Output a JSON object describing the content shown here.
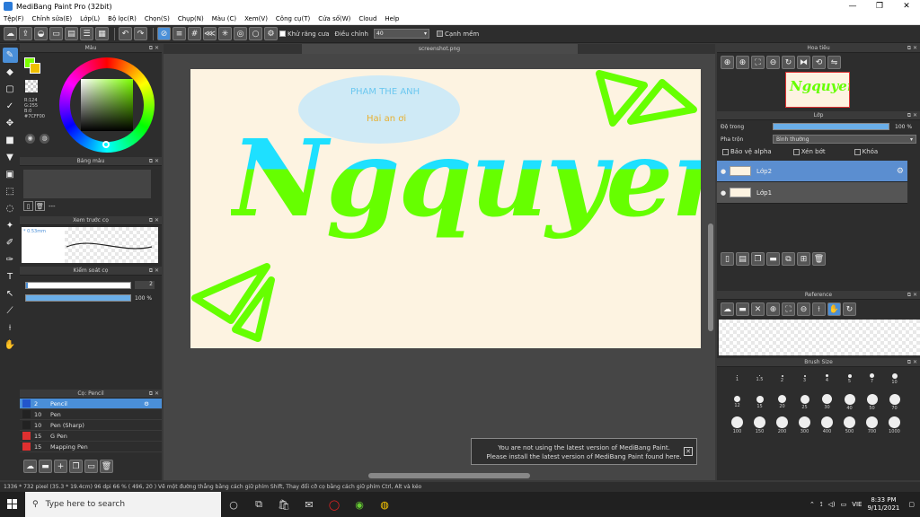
{
  "app": {
    "title": "MediBang Paint Pro (32bit)"
  },
  "window_controls": {
    "minimize": "—",
    "maximize": "❐",
    "close": "✕"
  },
  "menu": [
    "Tệp(F)",
    "Chỉnh sửa(E)",
    "Lớp(L)",
    "Bộ lọc(R)",
    "Chọn(S)",
    "Chụp(N)",
    "Màu (C)",
    "Xem(V)",
    "Công cụ(T)",
    "Cửa số(W)",
    "Cloud",
    "Help"
  ],
  "toolbar": {
    "antialias_label": "Khử răng cưa",
    "adjust_label": "Điều chỉnh",
    "adjust_value": "40",
    "snap_label": "Cạnh mềm"
  },
  "panels": {
    "color": {
      "title": "Màu",
      "r": "R:124",
      "g": "G:255",
      "b": "B:0",
      "hex": "#7CFF00",
      "accent": "#7cff00"
    },
    "palette": {
      "title": "Bảng màu",
      "extra": "---"
    },
    "preview": {
      "title": "Xem trước cọ",
      "size": "* 0.53mm"
    },
    "control": {
      "title": "Kiểm soát cọ",
      "size_value": "2",
      "opacity_value": "100 %"
    },
    "brush": {
      "title": "Cọ: Pencil",
      "items": [
        {
          "size": "2",
          "name": "Pencil",
          "color": "#2255cc",
          "selected": true
        },
        {
          "size": "10",
          "name": "Pen",
          "color": "#222222",
          "selected": false
        },
        {
          "size": "10",
          "name": "Pen (Sharp)",
          "color": "#222222",
          "selected": false
        },
        {
          "size": "15",
          "name": "G Pen",
          "color": "#e03030",
          "selected": false
        },
        {
          "size": "15",
          "name": "Mapping Pen",
          "color": "#e03030",
          "selected": false
        }
      ]
    }
  },
  "canvas": {
    "tab_name": "screenshot.png",
    "art": {
      "title_text": "Ngquyen",
      "note_line1": "PHAM THE ANH",
      "note_line2": "Hai an ơi"
    }
  },
  "right": {
    "navigator": {
      "title": "Hoa tiêu"
    },
    "layer": {
      "title": "Lớp",
      "opacity_label": "Độ trong",
      "opacity_value": "100 %",
      "blend_label": "Pha trộn",
      "blend_value": "Bình thường",
      "protect_alpha": "Bảo vệ alpha",
      "clip": "Xén bớt",
      "lock": "Khóa",
      "layers": [
        {
          "name": "Lớp2",
          "selected": true
        },
        {
          "name": "Lớp1",
          "selected": false
        }
      ]
    },
    "reference": {
      "title": "Reference"
    },
    "brush_size": {
      "title": "Brush Size",
      "sizes": [
        "1",
        "1.5",
        "2",
        "3",
        "4",
        "5",
        "7",
        "10",
        "12",
        "15",
        "20",
        "25",
        "30",
        "40",
        "50",
        "70",
        "100",
        "150",
        "200",
        "300",
        "400",
        "500",
        "700",
        "1000"
      ]
    }
  },
  "notification": {
    "line1": "You are not using the latest version of MediBang Paint.",
    "line2": "Please install the latest version of MediBang Paint found here.",
    "close": "✕"
  },
  "status": {
    "text": "1336 * 732 pixel  (35.3 * 19.4cm)  96 dpi  66 %  ( 496, 20 )  Vẽ một đường thẳng bằng cách giữ phím Shift, Thay đổi cỡ cọ bằng cách giữ phím Ctrl, Alt và kéo"
  },
  "taskbar": {
    "search_placeholder": "Type here to search",
    "lang": "VIE",
    "time": "8:33 PM",
    "date": "9/11/2021"
  }
}
